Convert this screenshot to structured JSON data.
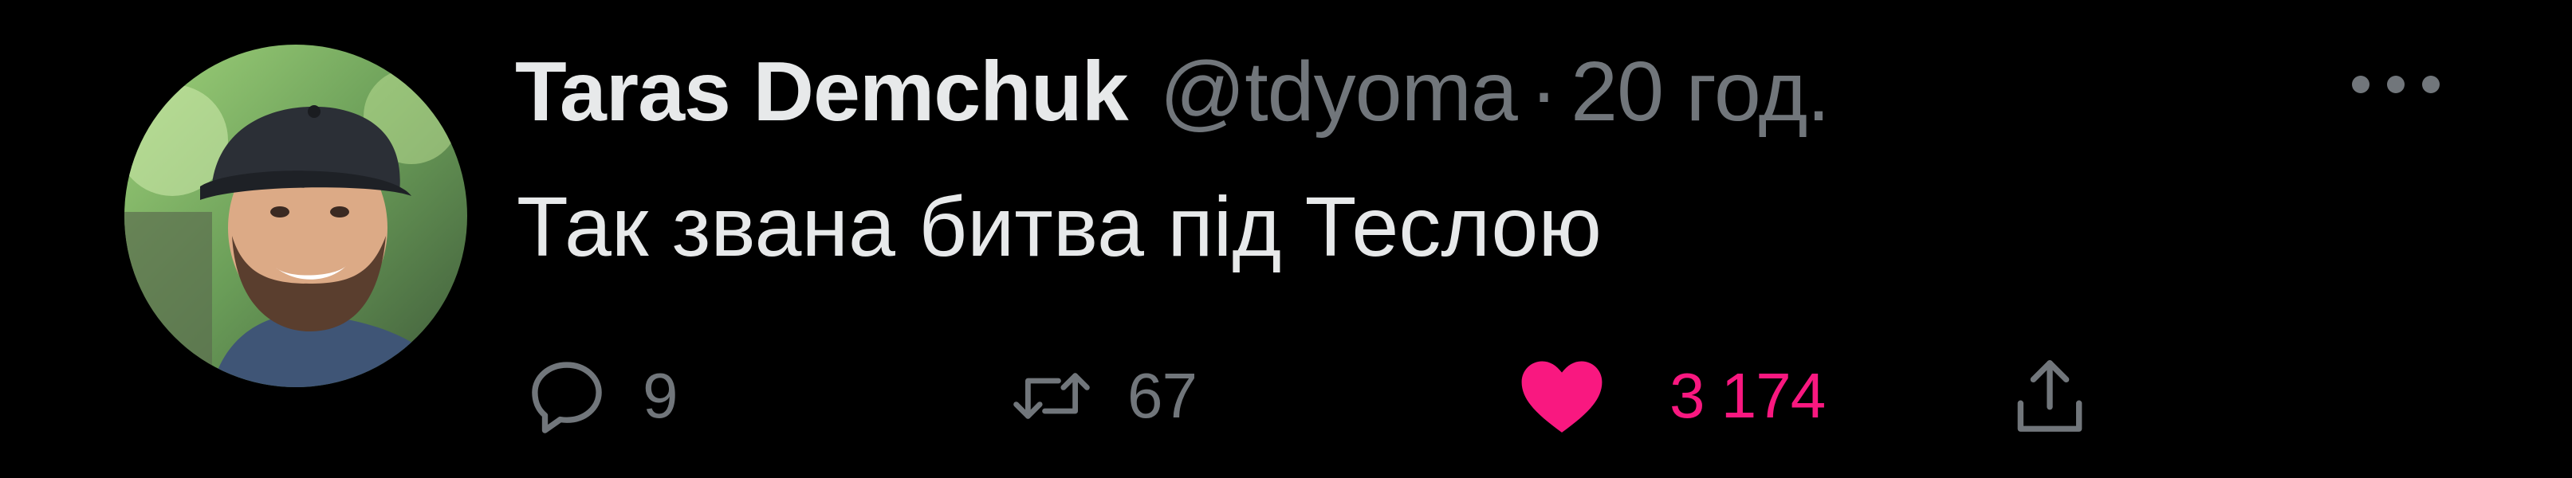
{
  "tweet": {
    "author": {
      "name": "Taras Demchuk",
      "handle": "@tdyoma",
      "avatar_icon": "user-avatar-photo"
    },
    "separator": "·",
    "time": "20 год.",
    "text": "Так звана битва під Теслою",
    "more_icon": "more-dots-icon",
    "actions": {
      "reply": {
        "icon": "reply-icon",
        "count": "9"
      },
      "retweet": {
        "icon": "retweet-icon",
        "count": "67"
      },
      "like": {
        "icon": "heart-icon",
        "count": "3 174",
        "liked": true
      },
      "share": {
        "icon": "share-icon"
      }
    }
  },
  "colors": {
    "background": "#000000",
    "primary_text": "#e7e9ea",
    "secondary_text": "#71767b",
    "like_active": "#f91880"
  }
}
